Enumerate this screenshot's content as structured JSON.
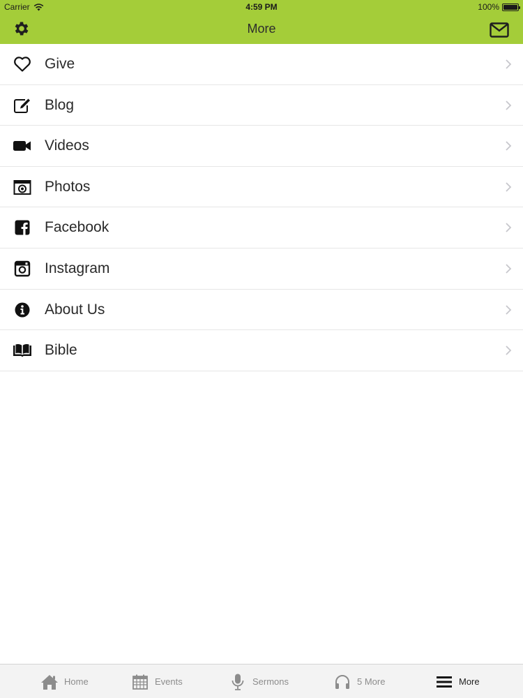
{
  "status_bar": {
    "carrier": "Carrier",
    "time": "4:59 PM",
    "battery": "100%"
  },
  "nav": {
    "title": "More",
    "left_icon": "gear-icon",
    "right_icon": "mail-icon"
  },
  "menu": {
    "items": [
      {
        "label": "Give",
        "icon": "heart-icon"
      },
      {
        "label": "Blog",
        "icon": "edit-icon"
      },
      {
        "label": "Videos",
        "icon": "video-camera-icon"
      },
      {
        "label": "Photos",
        "icon": "camera-icon"
      },
      {
        "label": "Facebook",
        "icon": "facebook-icon"
      },
      {
        "label": "Instagram",
        "icon": "instagram-icon"
      },
      {
        "label": "About Us",
        "icon": "info-icon"
      },
      {
        "label": "Bible",
        "icon": "book-icon"
      }
    ]
  },
  "tabbar": {
    "tabs": [
      {
        "label": "Home",
        "icon": "home-icon"
      },
      {
        "label": "Events",
        "icon": "calendar-icon"
      },
      {
        "label": "Sermons",
        "icon": "microphone-icon"
      },
      {
        "label": "5 More",
        "icon": "headphones-icon"
      },
      {
        "label": "More",
        "icon": "menu-icon",
        "active": true
      }
    ]
  },
  "colors": {
    "accent": "#a4cd39",
    "tab_inactive": "#8c8c8c",
    "tab_active": "#222222"
  }
}
